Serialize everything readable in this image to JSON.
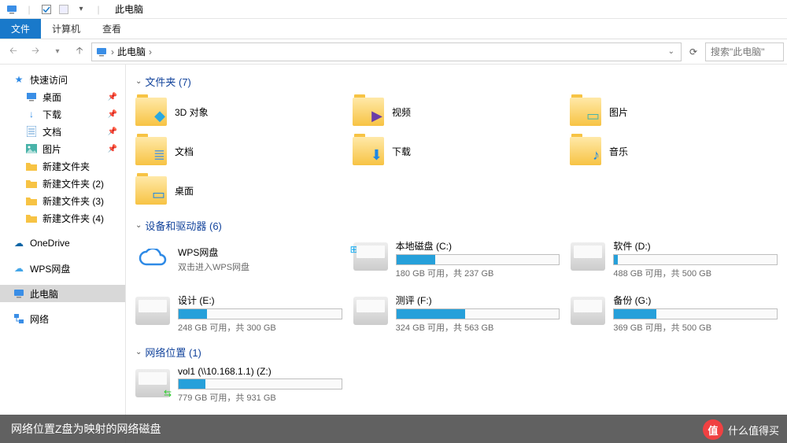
{
  "title": "此电脑",
  "ribbon": {
    "file": "文件",
    "computer": "计算机",
    "view": "查看"
  },
  "addr": {
    "root": "此电脑",
    "search_placeholder": "搜索\"此电脑\""
  },
  "sidebar": {
    "quick": "快速访问",
    "items": [
      {
        "label": "桌面",
        "icon": "monitor",
        "pin": true
      },
      {
        "label": "下载",
        "icon": "download",
        "pin": true
      },
      {
        "label": "文档",
        "icon": "doc",
        "pin": true
      },
      {
        "label": "图片",
        "icon": "pic",
        "pin": true
      },
      {
        "label": "新建文件夹",
        "icon": "folder"
      },
      {
        "label": "新建文件夹 (2)",
        "icon": "folder"
      },
      {
        "label": "新建文件夹 (3)",
        "icon": "folder"
      },
      {
        "label": "新建文件夹 (4)",
        "icon": "folder"
      }
    ],
    "onedrive": "OneDrive",
    "wps": "WPS网盘",
    "thispc": "此电脑",
    "network": "网络"
  },
  "sections": {
    "folders": {
      "title": "文件夹 (7)",
      "items": [
        {
          "label": "3D 对象",
          "overlay": "◆",
          "oc": "#2aa9e0"
        },
        {
          "label": "视频",
          "overlay": "▶",
          "oc": "#6a3da8"
        },
        {
          "label": "图片",
          "overlay": "▭",
          "oc": "#49b3a9"
        },
        {
          "label": "文档",
          "overlay": "≣",
          "oc": "#5b9bd5"
        },
        {
          "label": "下载",
          "overlay": "⬇",
          "oc": "#1e88e5"
        },
        {
          "label": "音乐",
          "overlay": "♪",
          "oc": "#1e88e5"
        },
        {
          "label": "桌面",
          "overlay": "▭",
          "oc": "#1e88e5"
        }
      ]
    },
    "drives": {
      "title": "设备和驱动器 (6)",
      "wps": {
        "name": "WPS网盘",
        "sub": "双击进入WPS网盘"
      },
      "items": [
        {
          "name": "本地磁盘 (C:)",
          "free": 180,
          "total": 237,
          "badge": "⊞"
        },
        {
          "name": "软件 (D:)",
          "free": 488,
          "total": 500
        },
        {
          "name": "设计 (E:)",
          "free": 248,
          "total": 300
        },
        {
          "name": "测评 (F:)",
          "free": 324,
          "total": 563
        },
        {
          "name": "备份 (G:)",
          "free": 369,
          "total": 500
        }
      ],
      "stat_tpl": " GB 可用，共 ",
      "stat_unit": " GB"
    },
    "netloc": {
      "title": "网络位置 (1)",
      "items": [
        {
          "name": "vol1 (\\\\10.168.1.1) (Z:)",
          "free": 779,
          "total": 931
        }
      ]
    }
  },
  "caption": "网络位置Z盘为映射的网络磁盘",
  "brand": {
    "glyph": "值",
    "text": "什么值得买"
  }
}
